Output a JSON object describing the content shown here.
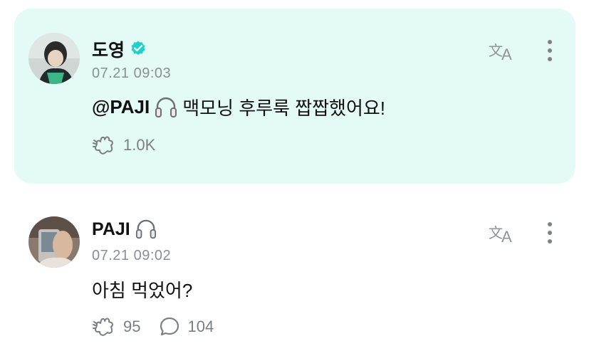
{
  "posts": [
    {
      "author": "도영",
      "verified": true,
      "time": "07.21 09:03",
      "mention": "@PAJI",
      "text": "맥모닝 후루룩 짭짭했어요!",
      "reaction_count": "1.0K",
      "highlighted": true
    },
    {
      "author": "PAJI",
      "time": "07.21 09:02",
      "text": "아침 먹었어?",
      "reaction_count": "95",
      "comment_count": "104",
      "highlighted": false
    }
  ],
  "colors": {
    "highlight_bg": "#e4faf6",
    "verified_badge": "#1fd1c8",
    "muted_text": "#8a8f93"
  },
  "icons": [
    "verified-badge-icon",
    "headphones-icon",
    "translate-icon",
    "more-vertical-icon",
    "reaction-icon",
    "comment-icon"
  ]
}
